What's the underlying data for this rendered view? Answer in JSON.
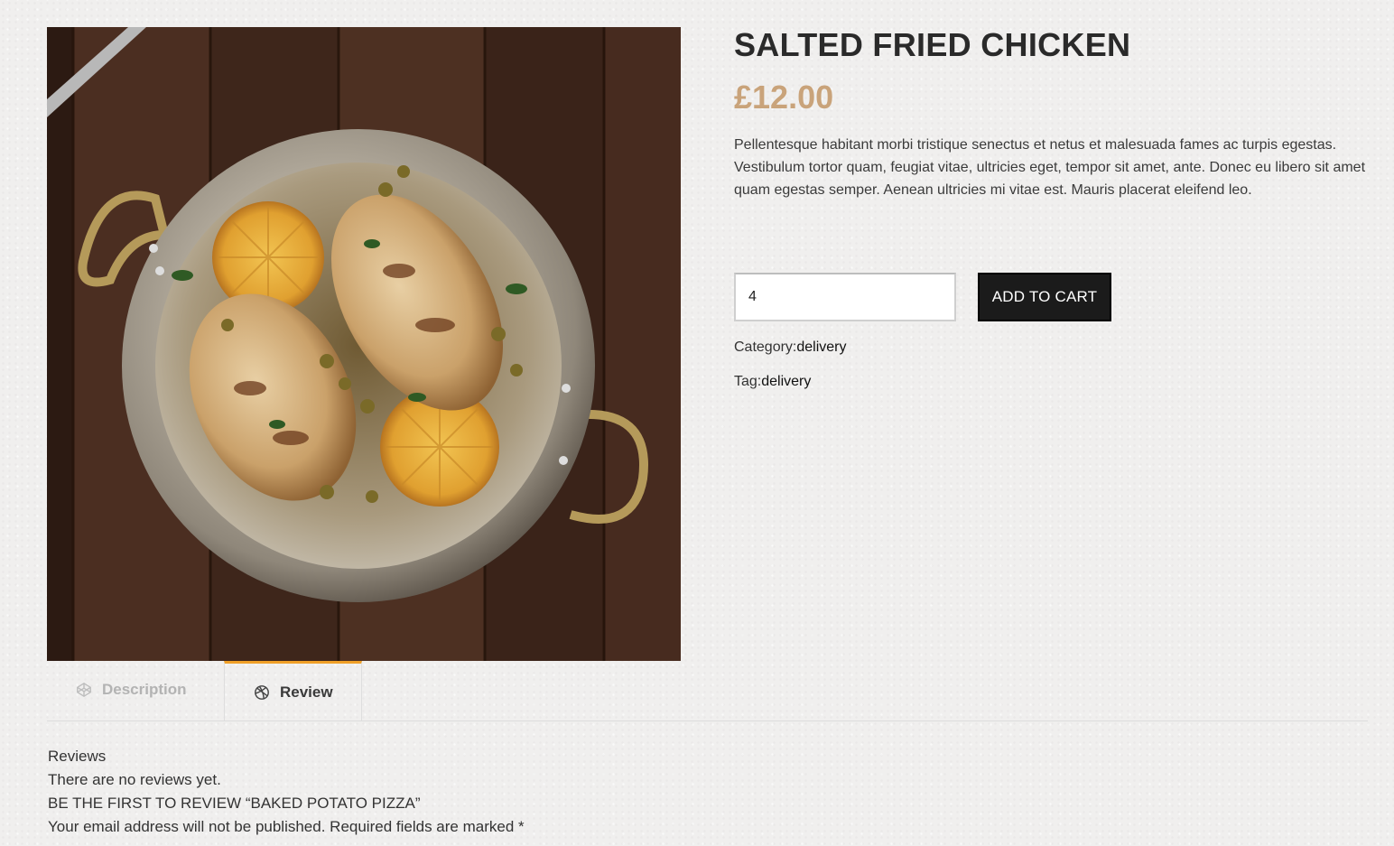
{
  "product": {
    "title": "SALTED FRIED CHICKEN",
    "price": "£12.00",
    "description": "Pellentesque habitant morbi tristique senectus et netus et malesuada fames ac turpis egestas. Vestibulum tortor quam, feugiat vitae, ultricies eget, tempor sit amet, ante. Donec eu libero sit amet quam egestas semper. Aenean ultricies mi vitae est. Mauris placerat eleifend leo.",
    "image_alt": "Fried chicken breasts with lemon slices and capers in a metal pan",
    "quantity": "4",
    "add_to_cart_label": "ADD TO CART",
    "category_label": "Category:",
    "category_value": "delivery",
    "tag_label": "Tag:",
    "tag_value": "delivery"
  },
  "tabs": [
    {
      "label": "Description",
      "icon": "codepen-icon",
      "active": false
    },
    {
      "label": "Review",
      "icon": "dribbble-icon",
      "active": true
    }
  ],
  "reviews": {
    "heading": "Reviews",
    "empty_text": "There are no reviews yet.",
    "first_review_prompt": "BE THE FIRST TO REVIEW “BAKED POTATO PIZZA”",
    "privacy_note": "Your email address will not be published. Required fields are marked *"
  },
  "colors": {
    "price": "#c9a37a",
    "active_tab_accent": "#f0a028",
    "button_bg": "#1b1b1b"
  }
}
